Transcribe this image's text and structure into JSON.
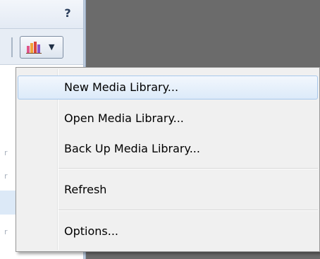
{
  "toolbar": {
    "help_label": "?",
    "library_button_icon": "library-bars-icon",
    "dropdown_icon": "chevron-down-icon"
  },
  "menu": {
    "items": [
      {
        "label": "New Media Library..."
      },
      {
        "label": "Open Media Library..."
      },
      {
        "label": "Back Up Media Library..."
      },
      {
        "label": "Refresh"
      },
      {
        "label": "Options..."
      }
    ]
  },
  "colors": {
    "menu_background": "#f0f0f0",
    "hover_border": "#a8c8ec",
    "hover_fill": "#dceaf9",
    "desktop_gray": "#6b6b6b"
  }
}
